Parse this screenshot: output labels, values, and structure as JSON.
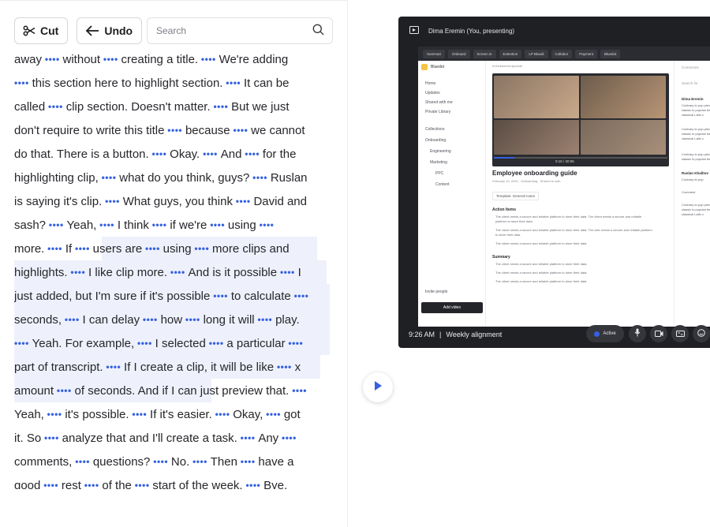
{
  "toolbar": {
    "cut_label": "Cut",
    "undo_label": "Undo"
  },
  "search": {
    "placeholder": "Search"
  },
  "transcript": {
    "lines": [
      [
        "away",
        "without",
        "creating a title.",
        "We're adding"
      ],
      [
        "",
        "this section here to highlight section.",
        "It can be"
      ],
      [
        "called",
        "clip section. Doesn't matter.",
        "But we just"
      ],
      [
        "don't require to write this title",
        "because",
        "we cannot"
      ],
      [
        "do that. There is a button.",
        "Okay.",
        "And",
        "for the"
      ],
      [
        "highlighting clip,",
        "what do you think, guys?",
        "Ruslan"
      ],
      [
        "is saying it's clip.",
        "What guys, you think",
        "David and"
      ],
      [
        "sash?",
        "Yeah,",
        "I think",
        "if we're",
        "using",
        ""
      ],
      [
        "more.",
        "If",
        "users are",
        "using",
        "more clips and"
      ],
      [
        "highlights.",
        "I like clip more.",
        "And is it possible",
        "I"
      ],
      [
        "just added, but I'm sure if it's possible",
        "to calculate",
        ""
      ],
      [
        "seconds,",
        "I can delay",
        "how",
        "long it will",
        "play."
      ],
      [
        "",
        "Yeah. For example,",
        "I selected",
        "a particular",
        ""
      ],
      [
        "part of transcript.",
        "If I create a clip, it will be like",
        "x"
      ],
      [
        "amount",
        "of seconds. And if I can just preview that.",
        ""
      ],
      [
        "Yeah,",
        "it's possible.",
        "If it's easier.",
        "Okay,",
        "got"
      ],
      [
        "it. So",
        "analyze that and I'll create a task.",
        "Any",
        ""
      ],
      [
        "comments,",
        "questions?",
        "No.",
        "Then",
        "have a"
      ],
      [
        "good",
        "rest",
        "of the",
        "start of the week.",
        "Bye."
      ]
    ],
    "dots": "••••"
  },
  "meeting": {
    "presenter": "Dima Eremin (You, presenting)",
    "time": "9:26 AM",
    "separator": "|",
    "title": "Weekly alignment",
    "active_label": "Active"
  },
  "shared_screen": {
    "tabs": [
      "Summari",
      "Onboard",
      "Screen in",
      "Extention",
      "LP Bluedi",
      "Collabor",
      "Payment",
      "Bluedot"
    ],
    "app_name": "Bluedot",
    "nav": [
      "Home",
      "Updates",
      "Shared with me",
      "Private Library"
    ],
    "collections_label": "Collections",
    "collections": [
      "Onboarding",
      "Engineering",
      "Marketing",
      "PPC",
      "Content"
    ],
    "invite_label": "Invite people",
    "add_video_label": "Add video",
    "url": "in.thebluedot.app/sdk",
    "video_time": "0:15 / 20:05",
    "doc_title": "Employee onboarding guide",
    "doc_date": "February 10, 2020",
    "doc_collection": "Onboarding",
    "doc_shared": "Shared to web",
    "template_label": "Template",
    "template_value": "General notes",
    "action_items_label": "Action Items",
    "action_items": [
      "The client needs a secure and reliable platform to store their data. The client needs a secure and reliable platform to store their data.",
      "The client needs a secure and reliable platform to store their data. The clier needs a secure and reliable platform to store their data.",
      "The client needs a secure and reliable platform to store their data."
    ],
    "summary_label": "Summary",
    "summary": [
      "The client needs a secure and reliable platform to store their data.",
      "The client needs a secure and reliable platform to store their data.",
      "The client needs a secure and reliable platform to store their data."
    ],
    "comments_label": "Comments",
    "comments_search": "Search for",
    "comments": [
      {
        "author": "Dima Eremin",
        "text": "Contrary to pop piece of classic to popular belie classical Latin c"
      },
      {
        "author": "",
        "text": "Contrary to pop piece of classic to popular belie classical Latin c"
      },
      {
        "author": "",
        "text": "Contrary to pop piece of classic to popular belie"
      },
      {
        "author": "Ruslan Khalitov",
        "text": "Contrary to pop"
      },
      {
        "author": "",
        "text": "Contrary to pop piece of classic to popular belie classical Latin c"
      }
    ],
    "comment_button": "Comment"
  },
  "colors": {
    "accent": "#3561e0",
    "highlight": "#eef1fb",
    "meeting_bg": "#1f2023"
  }
}
